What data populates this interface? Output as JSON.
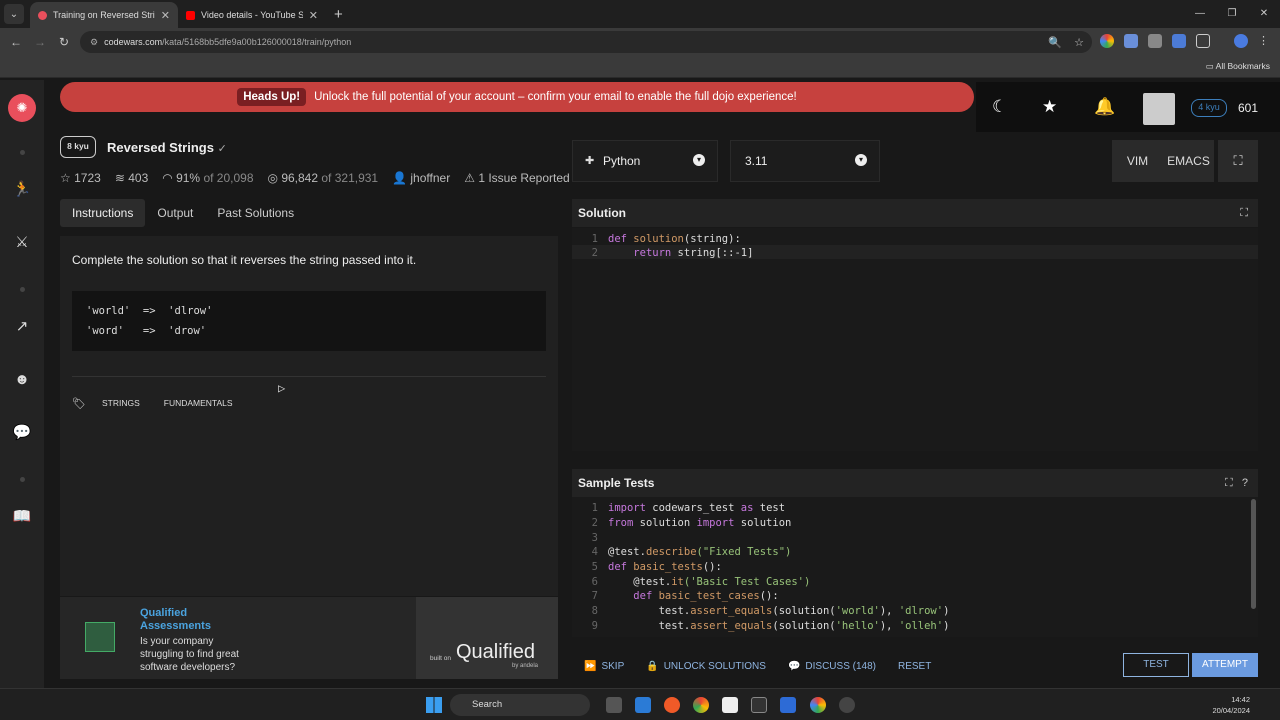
{
  "browser": {
    "tabs": [
      {
        "title": "Training on Reversed Strings |",
        "active": true,
        "favicon_color": "#e94f5c"
      },
      {
        "title": "Video details - YouTube Studio",
        "active": false,
        "favicon_color": "#ff0000"
      }
    ],
    "url_host": "codewars.com",
    "url_path": "/kata/5168bb5dfe9a00b126000018/train/python",
    "bookmarks_label": "All Bookmarks"
  },
  "banner": {
    "badge": "Heads Up!",
    "message": "Unlock the full potential of your account – confirm your email to enable the full dojo experience!"
  },
  "user": {
    "rank": "4 kyu",
    "honor": "601"
  },
  "kata": {
    "rank": "8 kyu",
    "title": "Reversed Strings",
    "stats": {
      "stars": "1723",
      "collections": "403",
      "satisfaction": "91%",
      "satisfaction_of": "of 20,098",
      "completed": "96,842",
      "completed_of": "of 321,931",
      "author": "jhoffner",
      "issues": "1 Issue Reported"
    },
    "tabs": [
      "Instructions",
      "Output",
      "Past Solutions"
    ],
    "instructions": "Complete the solution so that it reverses the string passed into it.",
    "example_lines": [
      "'world'  =>  'dlrow'",
      "'word'   =>  'drow'"
    ],
    "tags": [
      "STRINGS",
      "FUNDAMENTALS"
    ]
  },
  "ad": {
    "title": "Qualified Assessments",
    "text": "Is your company struggling to find great software developers? Start",
    "built_on": "built on",
    "brand": "Qualified",
    "by": "by andela"
  },
  "editor": {
    "language": "Python",
    "version": "3.11",
    "modes": [
      "VIM",
      "EMACS"
    ],
    "solution_label": "Solution",
    "sample_tests_label": "Sample Tests"
  },
  "solution_code": {
    "line_numbers": [
      "1",
      "2"
    ],
    "line1": {
      "kw": "def",
      "fn": "solution",
      "rest": "(string):"
    },
    "line2": {
      "indent": "    ",
      "kw": "return",
      "rest": " string[::-1]"
    }
  },
  "test_code": {
    "line_numbers": [
      "1",
      "2",
      "3",
      "4",
      "5",
      "6",
      "7",
      "8",
      "9"
    ],
    "lines": [
      {
        "kw": "import",
        "text": " codewars_test ",
        "kw2": "as",
        "text2": " test"
      },
      {
        "kw": "from",
        "text": " solution ",
        "kw2": "import",
        "text2": " solution"
      },
      {
        "text": ""
      },
      {
        "text": "@test.",
        "fn": "describe",
        "str": "(\"Fixed Tests\")"
      },
      {
        "kw": "def",
        "fn": " basic_tests",
        "text": "():"
      },
      {
        "text": "    @test.",
        "fn": "it",
        "str": "('Basic Test Cases')"
      },
      {
        "text": "    ",
        "kw": "def",
        "fn": " basic_test_cases",
        "text2": "():"
      },
      {
        "text": "        test.",
        "fn": "assert_equals",
        "text2": "(solution(",
        "str": "'world'",
        "text3": "), ",
        "str2": "'dlrow'",
        "text4": ")"
      },
      {
        "text": "        test.",
        "fn": "assert_equals",
        "text2": "(solution(",
        "str": "'hello'",
        "text3": "), ",
        "str2": "'olleh'",
        "text4": ")"
      }
    ]
  },
  "actions": {
    "skip": "SKIP",
    "unlock": "UNLOCK SOLUTIONS",
    "discuss": "DISCUSS (148)",
    "reset": "RESET",
    "test": "TEST",
    "attempt": "ATTEMPT"
  },
  "taskbar": {
    "search": "Search",
    "time": "14:42",
    "date": "20/04/2024"
  }
}
